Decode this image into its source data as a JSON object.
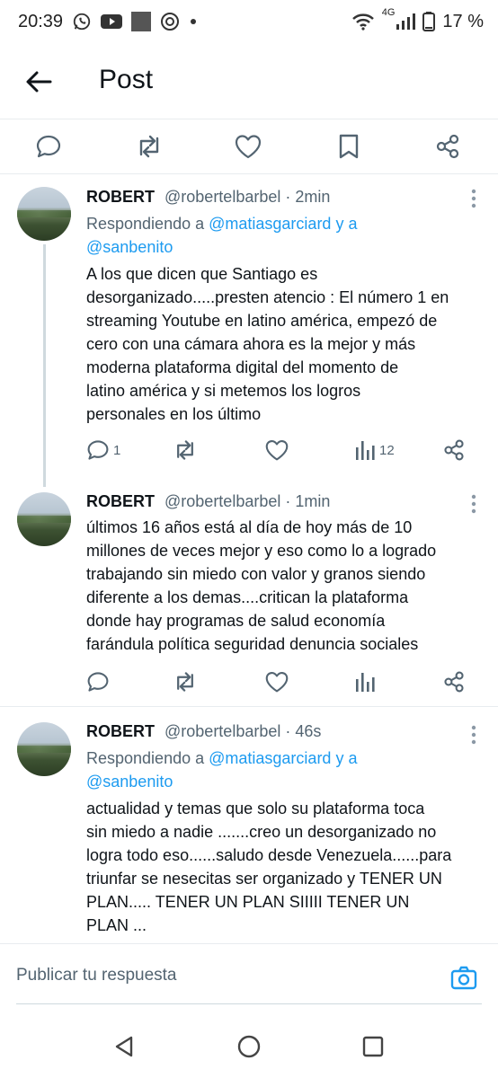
{
  "status_bar": {
    "time": "20:39",
    "network": "4G",
    "battery": "17 %",
    "left_icons": [
      "whatsapp-icon",
      "youtube-icon",
      "image-thumbnail-icon",
      "coin-icon",
      "dot-icon"
    ],
    "right_icons": [
      "wifi-icon",
      "signal-icon",
      "battery-icon"
    ]
  },
  "header": {
    "title": "Post"
  },
  "top_actions": [
    "reply-icon",
    "repost-icon",
    "like-icon",
    "bookmark-icon",
    "share-icon"
  ],
  "tweets": [
    {
      "name": "ROBERT",
      "handle": "@robertelbarbel",
      "time": "· 2min",
      "reply_prefix": "Respondiendo a",
      "reply_user1": "@matiasgarciard",
      "reply_and": "y a",
      "reply_user2": "@sanbenito",
      "text": "A los que dicen que Santiago es\ndesorganizado.....presten atencio : El número 1 en\nstreaming Youtube en latino américa, empezó de\ncero con una cámara ahora es la mejor y  más\nmoderna plataforma digital del momento de\nlatino américa y si metemos los logros\npersonales en los último",
      "replies": "1",
      "views": "12"
    },
    {
      "name": "ROBERT",
      "handle": "@robertelbarbel",
      "time": "· 1min",
      "text": "últimos 16 años está al día de hoy más de 10\nmillones de veces mejor y eso como lo a logrado\ntrabajando sin miedo con valor y granos siendo\ndiferente a los demas....critican la plataforma\ndonde hay programas de salud economía\nfarándula política seguridad  denuncia sociales"
    },
    {
      "name": "ROBERT",
      "handle": "@robertelbarbel",
      "time": "· 46s",
      "reply_prefix": "Respondiendo a",
      "reply_user1": "@matiasgarciard",
      "reply_and": "y a",
      "reply_user2": "@sanbenito",
      "text": "actualidad y temas que solo su plataforma toca\nsin miedo a nadie .......creo un desorganizado no\nlogra todo eso......saludo desde Venezuela......para\ntriunfar se nesecitas ser organizado y TENER UN\nPLAN..... TENER UN PLAN  SIIIII TENER UN\nPLAN ..."
    }
  ],
  "composer": {
    "placeholder": "Publicar tu respuesta"
  },
  "colors": {
    "accent": "#1d9bf0",
    "text": "#0f1419",
    "muted": "#536471",
    "divider": "#e8ecef"
  }
}
